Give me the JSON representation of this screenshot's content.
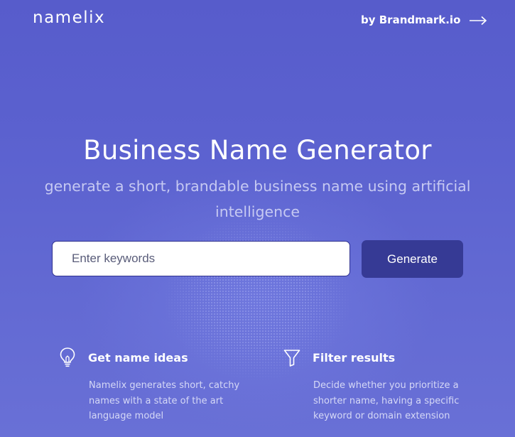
{
  "header": {
    "logo": "namelix",
    "by_link": "by Brandmark.io",
    "arrow_icon": "arrow-right-icon"
  },
  "hero": {
    "title": "Business Name Generator",
    "subtitle": "generate a short, brandable business name using artificial intelligence"
  },
  "search": {
    "placeholder": "Enter keywords",
    "value": "",
    "button_label": "Generate"
  },
  "features": [
    {
      "icon": "lightbulb-icon",
      "title": "Get name ideas",
      "description": "Namelix generates short, catchy names with a state of the art language model"
    },
    {
      "icon": "filter-icon",
      "title": "Filter results",
      "description": "Decide whether you prioritize a shorter name, having a specific keyword or domain extension"
    }
  ],
  "colors": {
    "background": "#5a5fcc",
    "button": "#363a95",
    "subtitle": "#c6c9f2"
  }
}
